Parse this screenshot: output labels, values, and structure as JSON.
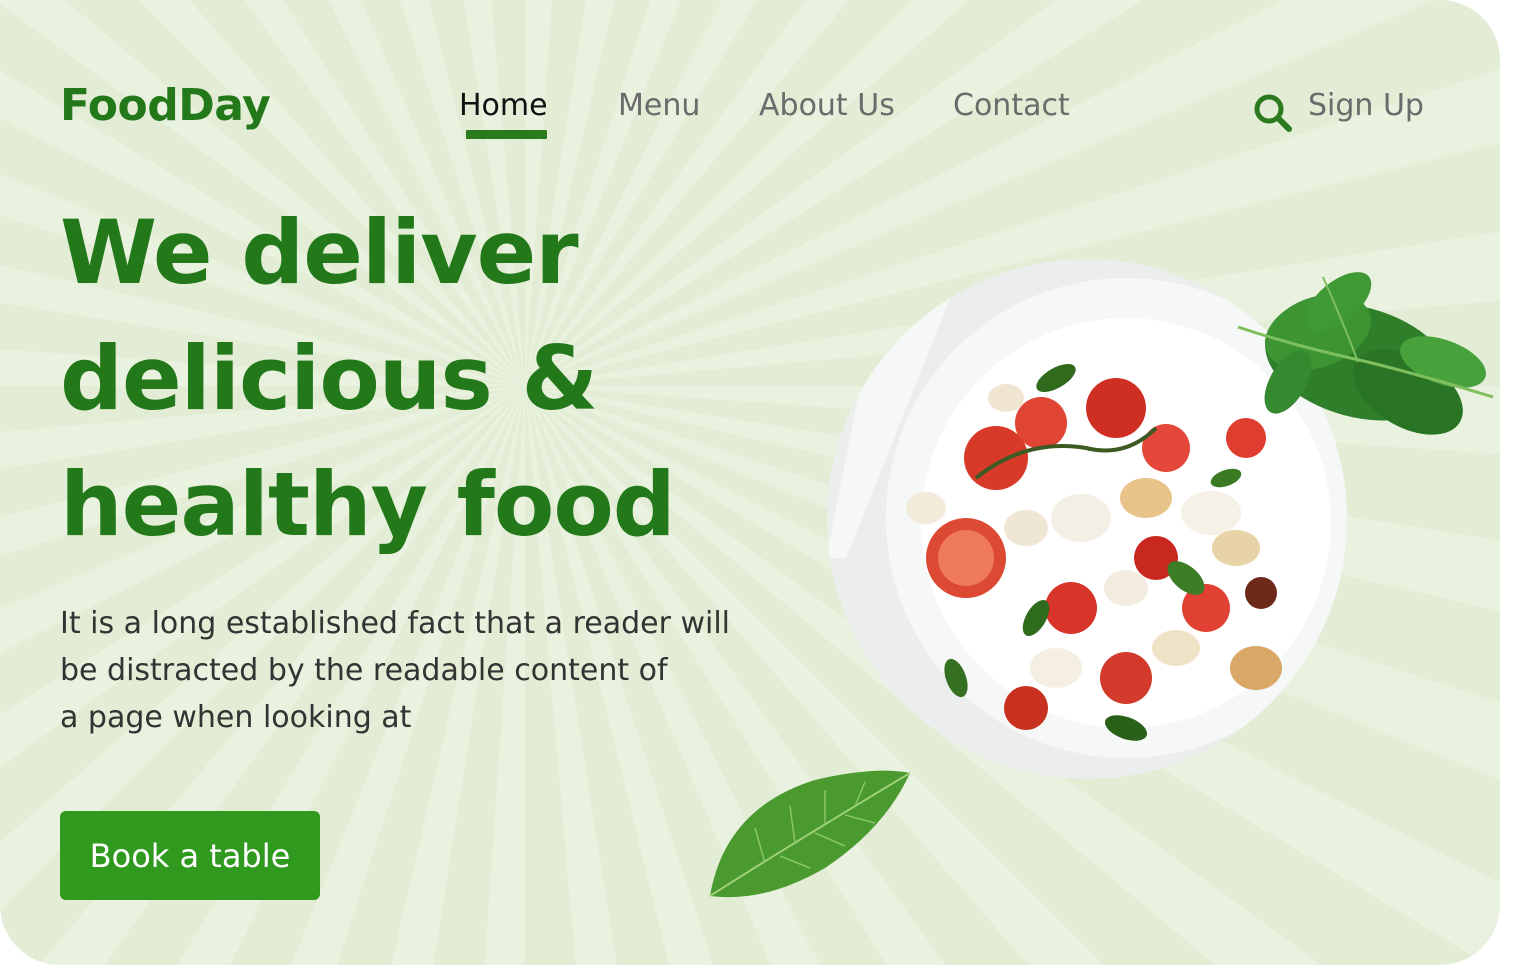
{
  "brand": {
    "name": "FoodDay"
  },
  "nav": {
    "items": [
      {
        "label": "Home",
        "active": true
      },
      {
        "label": "Menu",
        "active": false
      },
      {
        "label": "About Us",
        "active": false
      },
      {
        "label": "Contact",
        "active": false
      }
    ]
  },
  "header": {
    "search_icon": "search-icon",
    "signup_label": "Sign Up"
  },
  "hero": {
    "headline_lines": [
      "We deliver",
      "delicious &",
      "healthy food"
    ],
    "description_lines": [
      "It is a long established fact that a reader will",
      "be distracted by the readable content of",
      "a page when looking at"
    ],
    "cta_label": "Book a table"
  },
  "colors": {
    "brand_green": "#23781a",
    "button_green": "#2f9a1e",
    "background": "#e3edd6",
    "nav_text": "#6b6b6b"
  }
}
